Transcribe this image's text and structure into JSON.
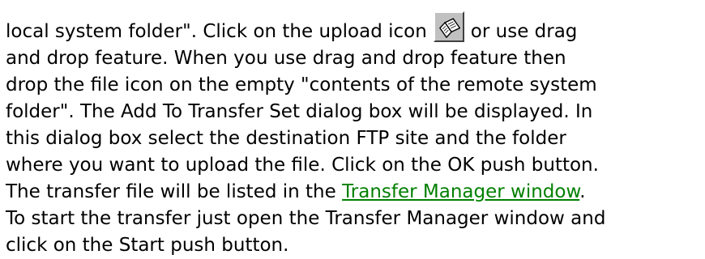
{
  "paragraph": {
    "line1_before_icon": "local system folder\". Click on the upload icon",
    "line1_after_icon": "or use drag",
    "line2": "and drop feature. When you use drag and drop feature then",
    "line3": "drop the file icon on the empty \"contents of the remote system",
    "line4": "folder\". The Add To Transfer Set dialog box will be displayed. In",
    "line5": "this dialog box select the destination FTP site and the folder",
    "line6": "where you want to upload the file. Click on the OK push button.",
    "line7_before_link": "The transfer file will be listed in the",
    "line7_link": "Transfer Manager window",
    "line7_after_link": ".",
    "line8": "To start the transfer just open the Transfer Manager window and",
    "line9": "click on the Start push button."
  },
  "icons": {
    "upload": "upload-book-icon"
  },
  "colors": {
    "link": "#008000",
    "button_face": "#c0c0c0"
  }
}
